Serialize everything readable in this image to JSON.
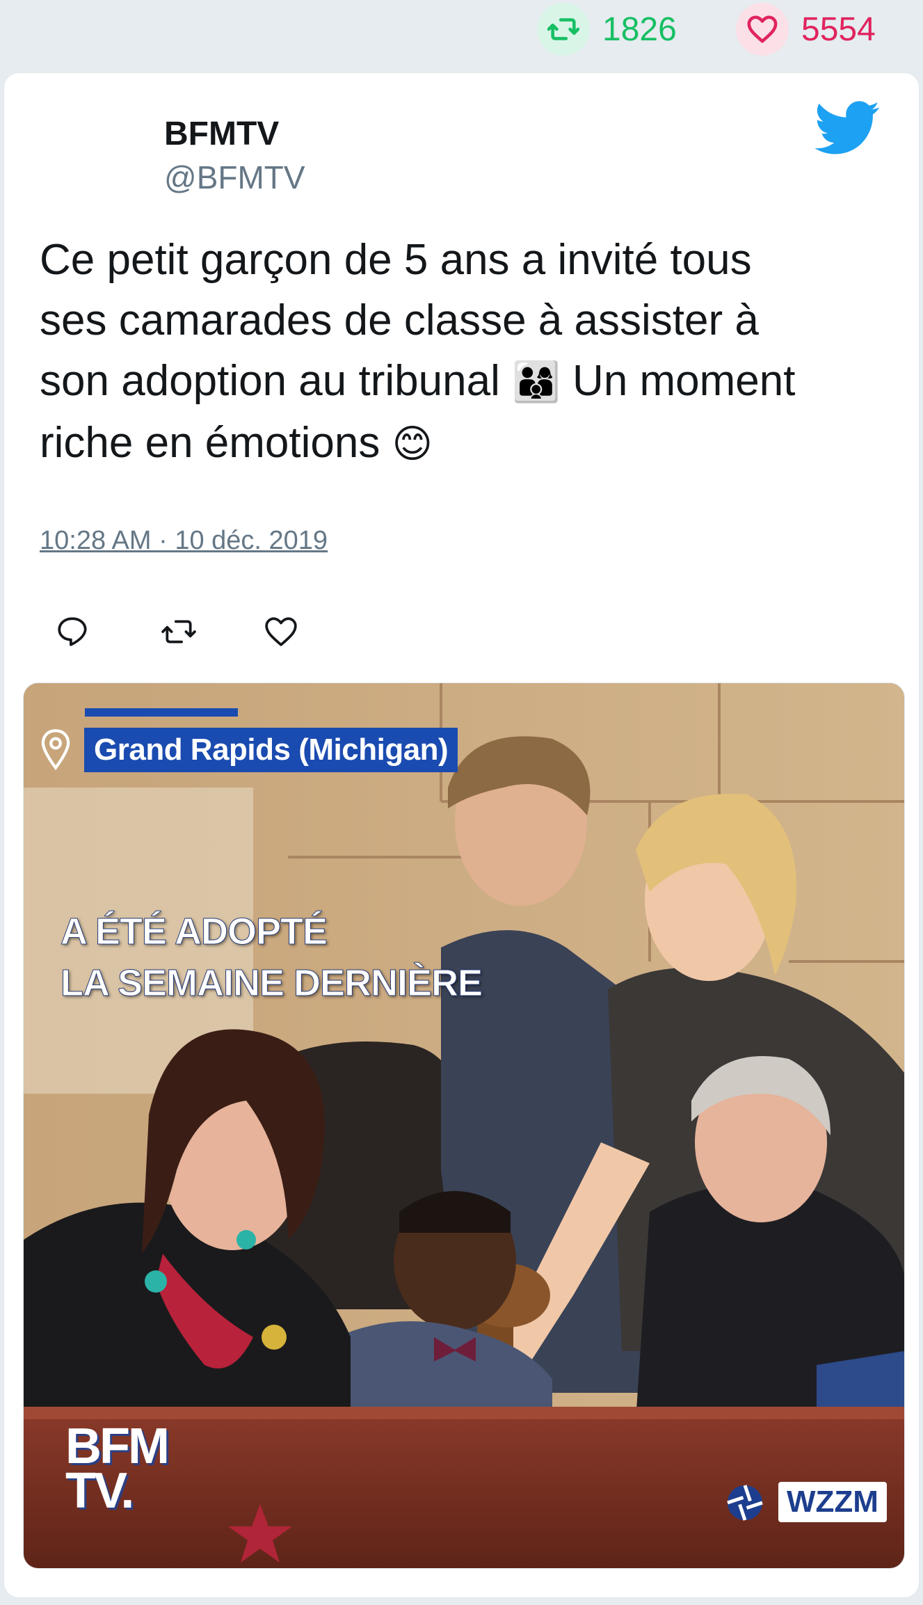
{
  "stats": {
    "retweet_icon": "retweet-icon",
    "retweet_count": "1826",
    "like_icon": "heart-icon",
    "like_count": "5554",
    "retweet_color": "#17bf63",
    "like_color": "#e0245e"
  },
  "tweet": {
    "display_name": "BFMTV",
    "handle": "@BFMTV",
    "brand_icon": "twitter-bird-icon",
    "text_line1": "Ce petit garçon de 5 ans a invité tous",
    "text_line2": "ses camarades de classe à assister à",
    "text_line3a": "son adoption au tribunal ",
    "emoji_family": "👨‍👩‍👦",
    "text_line3b": " Un moment",
    "text_line4": "riche en émotions ",
    "emoji_smile": "😊",
    "timestamp": "10:28 AM · 10 déc. 2019",
    "actions": [
      "reply-icon",
      "retweet-icon",
      "heart-icon"
    ]
  },
  "media": {
    "location": "Grand Rapids (Michigan)",
    "caption_line1": "A ÉTÉ ADOPTÉ",
    "caption_line2": "LA SEMAINE DERNIÈRE",
    "logo_line1": "BFM",
    "logo_line2": "TV.",
    "source": "WZZM",
    "accent_color": "#1a4bb0"
  }
}
